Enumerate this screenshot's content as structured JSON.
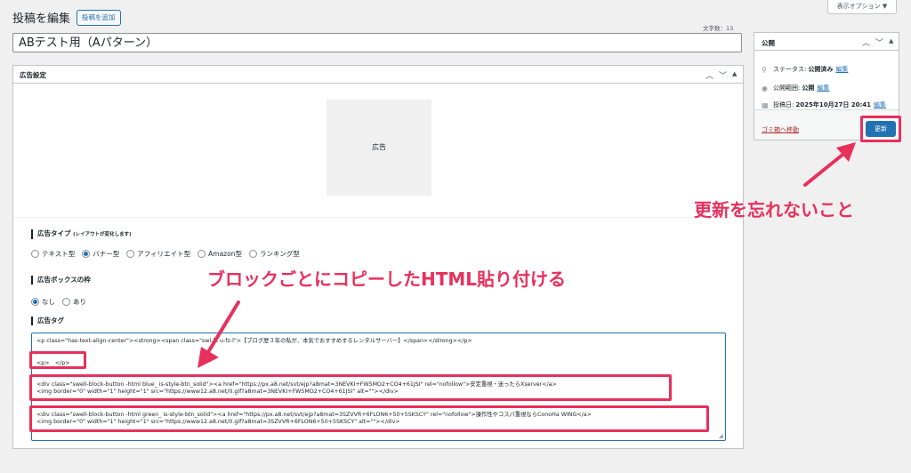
{
  "header": {
    "title": "投稿を編集",
    "add_new": "投稿を追加",
    "screen_options": "表示オプション ▼",
    "char_count": "文字数：13",
    "post_title": "ABテスト用（Aパターン）"
  },
  "ad_box": {
    "title": "広告設定",
    "preview_label": "広告",
    "type_label": "広告タイプ",
    "type_note": "(レイアウトが変化します)",
    "types": [
      "テキスト型",
      "バナー型",
      "アフィリエイト型",
      "Amazon型",
      "ランキング型"
    ],
    "frame_label": "広告ボックスの枠",
    "frames": [
      "なし",
      "あり"
    ],
    "tag_label": "広告タグ"
  },
  "code": {
    "line1": "<p class=\"has-text-align-center\"><strong><span class=\"swl-fz u-fz-l\">【ブログ歴３年の私が、本気でおすすめするレンタルサーバー】</span></strong></p>",
    "line2": "<p>　</p>",
    "line3": "<div class=\"swell-block-button -html blue_ is-style-btn_solid\"><a href=\"https://px.a8.net/svt/ejp?a8mat=3NEVKI+FW5MO2+CO4+61JSI\" rel=\"nofollow\">安定重視・迷ったらXserver</a>",
    "line4": "<img border=\"0\" width=\"1\" height=\"1\" src=\"https://www12.a8.net/0.gif?a8mat=3NEVKI+FW5MO2+CO4+61JSI\" alt=\"\"></div>",
    "line5": "<div class=\"swell-block-button -html green_ is-style-btn_solid\"><a href=\"https://px.a8.net/svt/ejp?a8mat=3SZVVR+6FLON6+50+5SKSCY\" rel=\"nofollow\">操作性やコスパ重視ならConoHa WING</a>",
    "line6": "<img border=\"0\" width=\"1\" height=\"1\" src=\"https://www12.a8.net/0.gif?a8mat=3SZVVR+6FLON6+50+5SKSCY\" alt=\"\"></div>"
  },
  "publish": {
    "title": "公開",
    "status_label": "ステータス:",
    "status_value": "公開済み",
    "visibility_label": "公開範囲:",
    "visibility_value": "公開",
    "date_label": "投稿日:",
    "date_value": "2025年10月27日 20:41",
    "edit": "編集",
    "trash": "ゴミ箱へ移動",
    "update": "更新"
  },
  "annotations": {
    "update_note": "更新を忘れないこと",
    "paste_note": "ブロックごとにコピーしたHTML貼り付ける"
  },
  "colors": {
    "accent": "#2271b1",
    "highlight": "#e8305c"
  }
}
